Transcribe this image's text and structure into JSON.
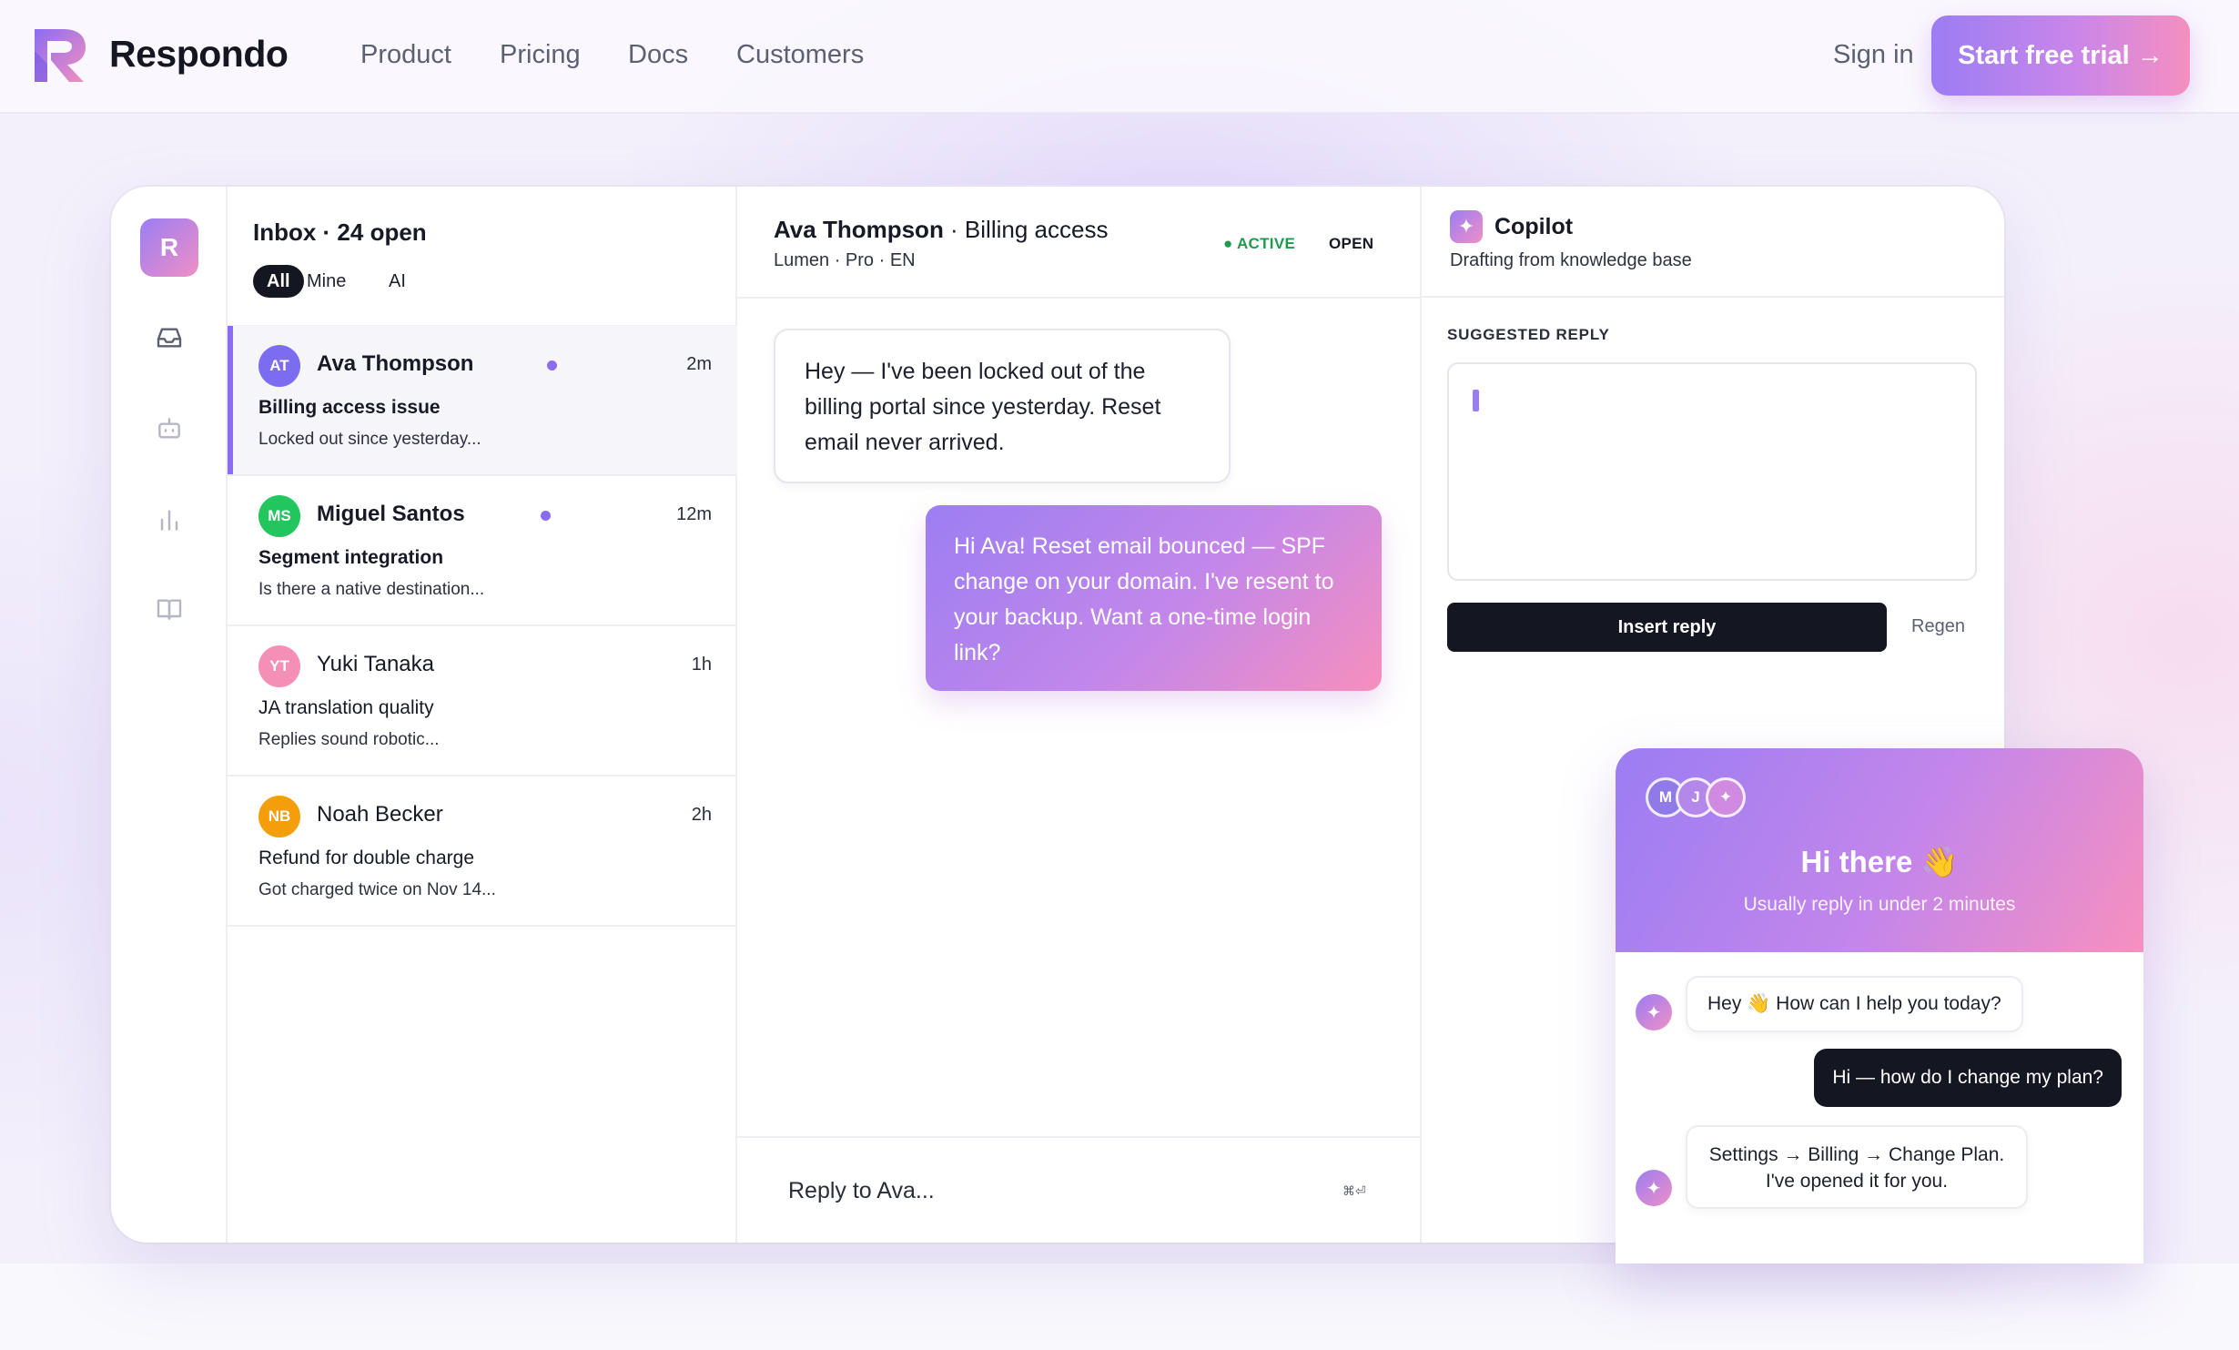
{
  "nav": {
    "brand": "Respondo",
    "links": [
      "Product",
      "Pricing",
      "Docs",
      "Customers"
    ],
    "sign_in": "Sign in",
    "cta": "Start free trial →"
  },
  "colors": {
    "accent": "#8a6cf0",
    "gradient_start": "#9b7df3",
    "gradient_end": "#f58fbf",
    "dark": "#141722",
    "active_green": "#1f9a4e"
  },
  "app": {
    "rail": {
      "logo_letter": "R",
      "icons": [
        "inbox-icon",
        "bot-icon",
        "analytics-icon",
        "book-icon"
      ]
    },
    "inbox": {
      "title": "Inbox · 24 open",
      "filters": [
        "All",
        "Mine",
        "AI"
      ],
      "active_filter": "All",
      "conversations": [
        {
          "initials": "AT",
          "name": "Ava Thompson",
          "time": "2m",
          "subject": "Billing access issue",
          "preview": "Locked out since yesterday...",
          "unread": true,
          "color": "#7c6cf0"
        },
        {
          "initials": "MS",
          "name": "Miguel Santos",
          "time": "12m",
          "subject": "Segment integration",
          "preview": "Is there a native destination...",
          "unread": true,
          "color": "#22c55e"
        },
        {
          "initials": "YT",
          "name": "Yuki Tanaka",
          "time": "1h",
          "subject": "JA translation quality",
          "preview": "Replies sound robotic...",
          "unread": false,
          "color": "#f58fb6"
        },
        {
          "initials": "NB",
          "name": "Noah Becker",
          "time": "2h",
          "subject": "Refund for double charge",
          "preview": "Got charged twice on Nov 14...",
          "unread": false,
          "color": "#f59e0b"
        }
      ]
    },
    "thread": {
      "contact": "Ava Thompson",
      "topic": " · Billing access",
      "meta": "Lumen · Pro · EN",
      "status_active": "● ACTIVE",
      "status_open": "OPEN",
      "messages": [
        {
          "from": "customer",
          "text": "Hey — I've been locked out of the billing portal since yesterday. Reset email never arrived."
        },
        {
          "from": "agent",
          "text": "Hi Ava! Reset email bounced — SPF change on your domain. I've resent to your backup. Want a one-time login link?"
        }
      ],
      "reply_placeholder": "Reply to Ava...",
      "reply_shortcut": "⌘⏎"
    },
    "copilot": {
      "title": "Copilot",
      "subtitle": "Drafting from knowledge base",
      "suggest_label": "SUGGESTED REPLY",
      "insert_label": "Insert reply",
      "regen_label": "Regen"
    }
  },
  "widget": {
    "avatars": [
      "M",
      "J",
      "✦"
    ],
    "title": "Hi there 👋",
    "subtitle": "Usually reply in under 2 minutes",
    "messages": [
      {
        "from": "bot",
        "text": "Hey 👋 How can I help you today?"
      },
      {
        "from": "user",
        "text": "Hi — how do I change my plan?"
      },
      {
        "from": "bot",
        "text": "Settings → Billing → Change Plan. I've opened it for you."
      }
    ]
  }
}
